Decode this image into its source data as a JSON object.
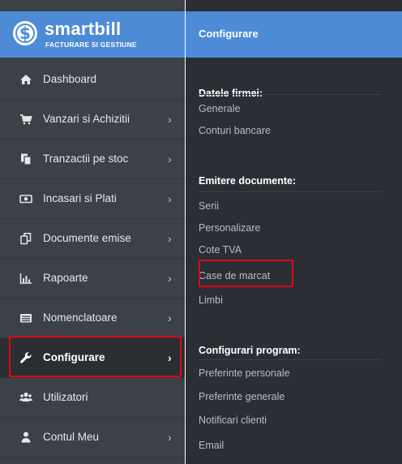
{
  "brand": {
    "name": "smartbill",
    "tagline": "FACTURARE SI GESTIUNE",
    "logo_icon": "dollar-circle-icon",
    "color": "#4d8bd6"
  },
  "sidebar": {
    "items": [
      {
        "label": "Dashboard",
        "icon": "home-icon",
        "chevron": ""
      },
      {
        "label": "Vanzari si Achizitii",
        "icon": "cart-icon",
        "chevron": "›"
      },
      {
        "label": "Tranzactii pe stoc",
        "icon": "copy-icon",
        "chevron": "›"
      },
      {
        "label": "Incasari si Plati",
        "icon": "money-icon",
        "chevron": "›"
      },
      {
        "label": "Documente emise",
        "icon": "documents-icon",
        "chevron": "›"
      },
      {
        "label": "Rapoarte",
        "icon": "bar-chart-icon",
        "chevron": "›"
      },
      {
        "label": "Nomenclatoare",
        "icon": "list-icon",
        "chevron": "›"
      },
      {
        "label": "Configurare",
        "icon": "wrench-icon",
        "chevron": "›",
        "active": true
      },
      {
        "label": "Utilizatori",
        "icon": "users-icon",
        "chevron": ""
      },
      {
        "label": "Contul Meu",
        "icon": "user-icon",
        "chevron": "›"
      }
    ]
  },
  "panel": {
    "title": "Configurare",
    "sections": [
      {
        "title": "Datele firmei:",
        "links": [
          "Generale",
          "Conturi bancare"
        ]
      },
      {
        "title": "Emitere documente:",
        "links": [
          "Serii",
          "Personalizare",
          "Cote TVA",
          "Case de marcat",
          "Limbi"
        ]
      },
      {
        "title": "Configurari program:",
        "links": [
          "Preferinte personale",
          "Preferinte generale",
          "Notificari clienti",
          "Email"
        ]
      }
    ]
  },
  "colors": {
    "highlight": "#e30613",
    "sidebar_bg": "#3c4047",
    "panel_bg": "#2b2f35"
  }
}
